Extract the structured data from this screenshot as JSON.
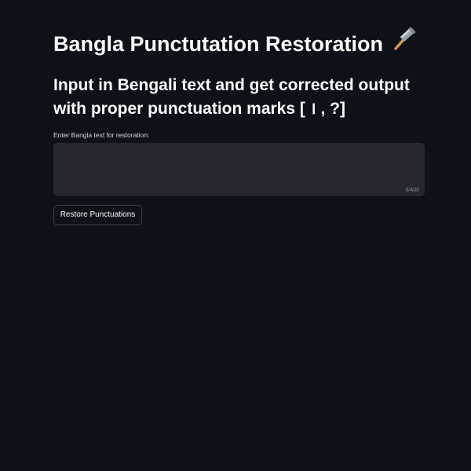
{
  "page": {
    "title": "Bangla Punctutation Restoration",
    "title_icon": "hammer-icon",
    "subtitle": "Input in Bengali text and get corrected output with proper punctuation marks [ । , ?]"
  },
  "form": {
    "input_label": "Enter Bangla text for restoration:",
    "input_value": "",
    "char_count": "0/400",
    "submit_label": "Restore Punctuations"
  },
  "colors": {
    "background": "#0e1117",
    "input_background": "#262730",
    "text": "#fafafa",
    "button_border": "#3b3d47"
  }
}
